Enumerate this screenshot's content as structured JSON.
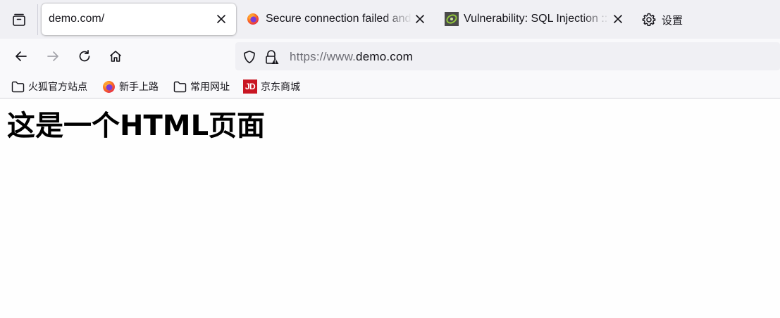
{
  "tabs": [
    {
      "title": "demo.com/",
      "active": true,
      "favicon": "none"
    },
    {
      "title": "Secure connection failed and Firefox did not connect",
      "active": false,
      "favicon": "firefox-icon"
    },
    {
      "title": "Vulnerability: SQL Injection :: Damn Vulnerable Web Application",
      "active": false,
      "favicon": "dvwa-icon"
    }
  ],
  "settings_label": "设置",
  "url": {
    "scheme_prefix": "https://www.",
    "host": "demo.com"
  },
  "bookmarks": [
    {
      "label": "火狐官方站点",
      "icon": "folder-icon"
    },
    {
      "label": "新手上路",
      "icon": "firefox-icon"
    },
    {
      "label": "常用网址",
      "icon": "folder-icon"
    },
    {
      "label": "京东商城",
      "icon": "jd-icon",
      "icon_text": "JD"
    }
  ],
  "page": {
    "heading": "这是一个HTML页面"
  },
  "colors": {
    "tabstrip_bg": "#f0f0f4",
    "toolbar_bg": "#f9f9fb",
    "urlbar_bg": "#f0f0f4",
    "jd_red": "#c91623"
  }
}
